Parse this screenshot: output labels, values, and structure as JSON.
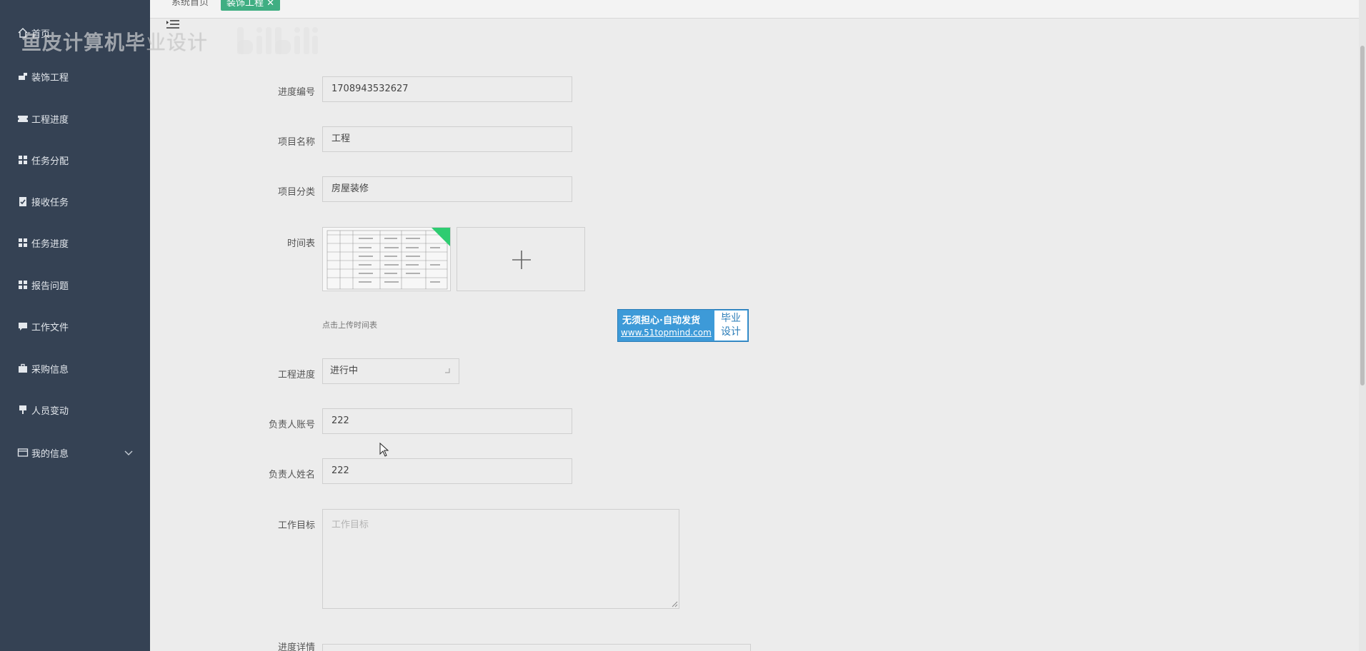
{
  "watermark": {
    "text_bold": "鱼皮计算机毕",
    "text_light": "业设计"
  },
  "sidebar": {
    "items": [
      {
        "label": "首页",
        "icon": "home-icon"
      },
      {
        "label": "装饰工程",
        "icon": "paint-roller-icon"
      },
      {
        "label": "工程进度",
        "icon": "ticket-icon"
      },
      {
        "label": "任务分配",
        "icon": "grid-icon"
      },
      {
        "label": "接收任务",
        "icon": "clipboard-check-icon"
      },
      {
        "label": "任务进度",
        "icon": "grid-icon"
      },
      {
        "label": "报告问题",
        "icon": "grid-icon"
      },
      {
        "label": "工作文件",
        "icon": "chat-icon"
      },
      {
        "label": "采购信息",
        "icon": "briefcase-icon"
      },
      {
        "label": "人员变动",
        "icon": "stamp-icon"
      },
      {
        "label": "我的信息",
        "icon": "id-card-icon"
      }
    ]
  },
  "topbar": {
    "home_tab": "系统首页",
    "active_tab": "装饰工程"
  },
  "form": {
    "progress_no_label": "进度编号",
    "progress_no_value": "1708943532627",
    "project_name_label": "项目名称",
    "project_name_value": "工程",
    "project_category_label": "项目分类",
    "project_category_value": "房屋装修",
    "schedule_label": "时间表",
    "upload_hint": "点击上传时间表",
    "engineering_progress_label": "工程进度",
    "engineering_progress_value": "进行中",
    "owner_account_label": "负责人账号",
    "owner_account_value": "222",
    "owner_name_label": "负责人姓名",
    "owner_name_value": "222",
    "work_goal_label": "工作目标",
    "work_goal_placeholder": "工作目标",
    "progress_detail_label": "进度详情"
  },
  "ad": {
    "line1": "无须担心·自动发货",
    "line2": "www.51topmind.com",
    "side_top": "毕业",
    "side_bottom": "设计"
  },
  "colors": {
    "sidebar_bg": "#354254",
    "accent": "#3fae82",
    "content_bg": "#ececec"
  }
}
